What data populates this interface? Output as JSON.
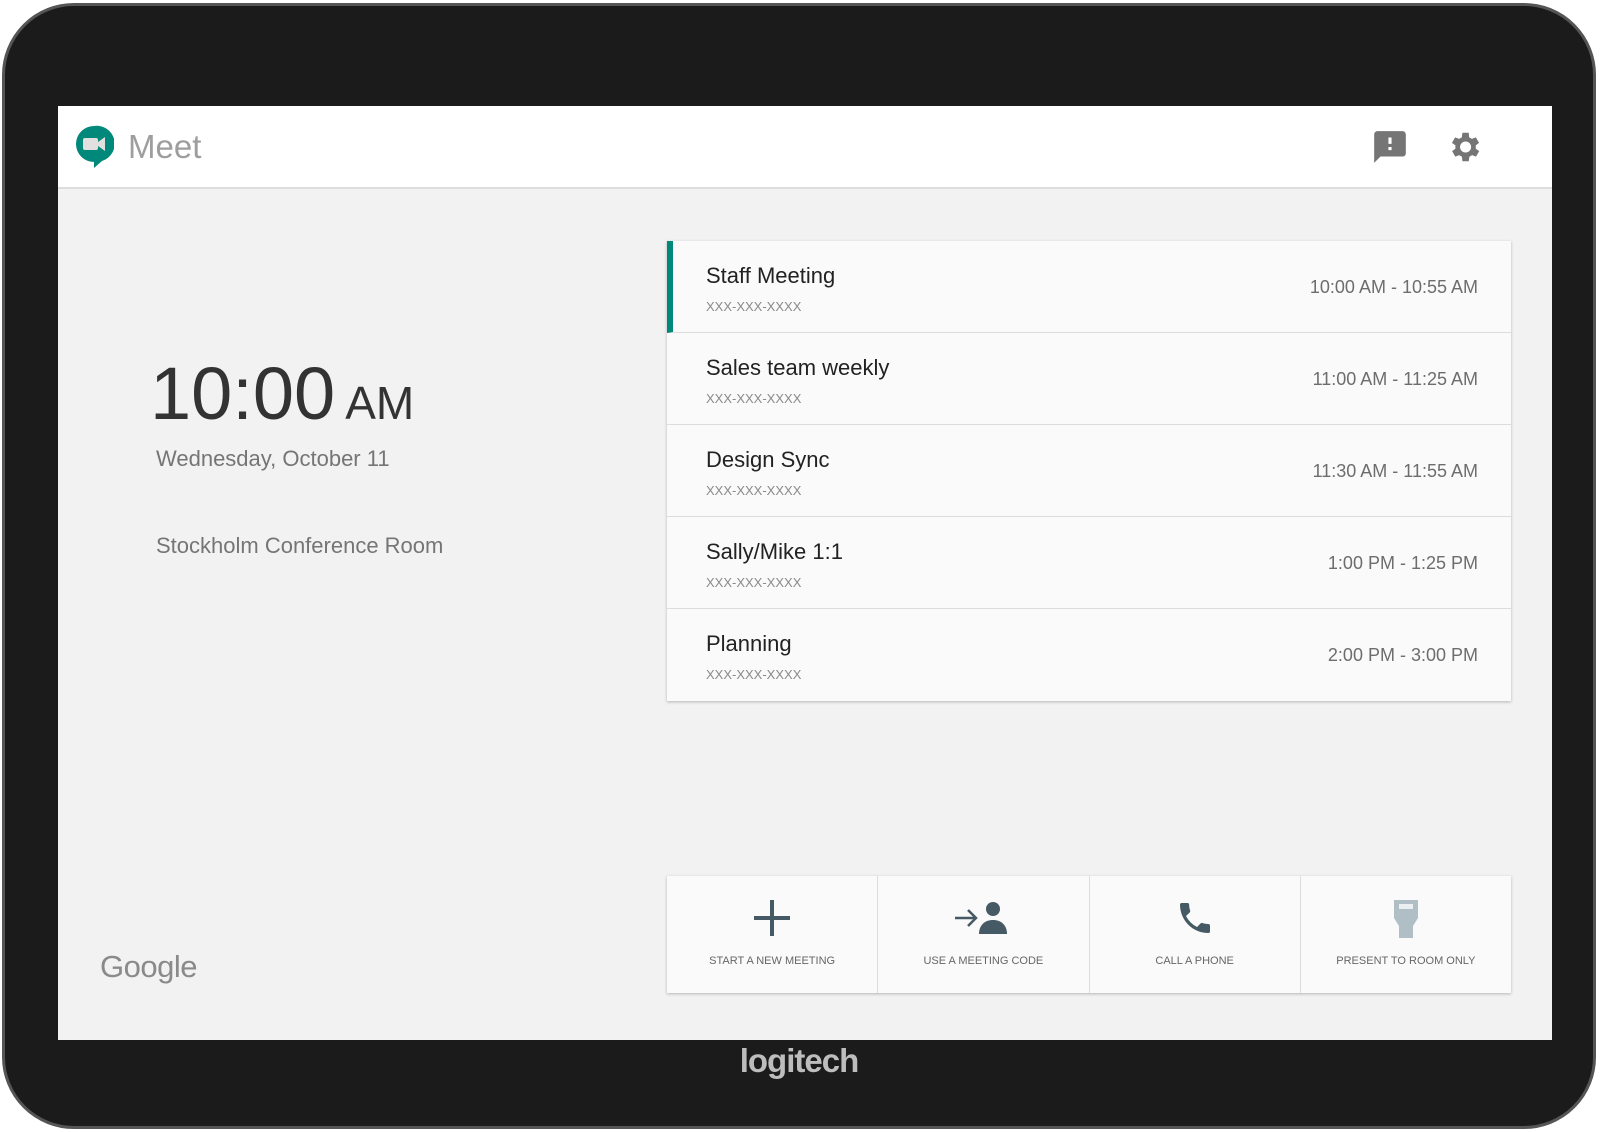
{
  "app": {
    "title": "Meet",
    "brand": "logitech",
    "footer_logo": "Google"
  },
  "header": {
    "icons": [
      "feedback-icon",
      "settings-icon"
    ]
  },
  "clock": {
    "time": "10:00",
    "ampm": "AM",
    "date": "Wednesday, October 11",
    "room": "Stockholm Conference Room"
  },
  "meetings": [
    {
      "name": "Staff Meeting",
      "code": "XXX-XXX-XXXX",
      "time": "10:00 AM - 10:55 AM",
      "active": true
    },
    {
      "name": "Sales team weekly",
      "code": "XXX-XXX-XXXX",
      "time": "11:00 AM - 11:25 AM"
    },
    {
      "name": "Design Sync",
      "code": "XXX-XXX-XXXX",
      "time": "11:30 AM - 11:55 AM"
    },
    {
      "name": "Sally/Mike 1:1",
      "code": "XXX-XXX-XXXX",
      "time": "1:00 PM - 1:25 PM"
    },
    {
      "name": "Planning",
      "code": "XXX-XXX-XXXX",
      "time": "2:00 PM - 3:00 PM"
    }
  ],
  "actions": [
    {
      "label": "START A NEW MEETING",
      "icon": "plus-icon"
    },
    {
      "label": "USE A MEETING CODE",
      "icon": "person-join-icon"
    },
    {
      "label": "CALL A PHONE",
      "icon": "phone-icon"
    },
    {
      "label": "PRESENT TO ROOM ONLY",
      "icon": "hdmi-icon"
    }
  ],
  "colors": {
    "accent": "#00897b",
    "icon": "#455a64",
    "icon_disabled": "#b0bec5"
  }
}
